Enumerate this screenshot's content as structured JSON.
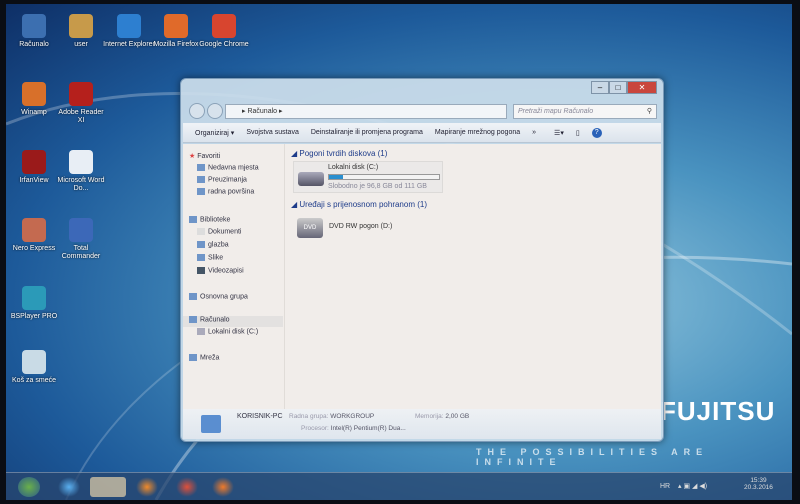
{
  "desktop": {
    "icons": [
      {
        "label": "Računalo",
        "color": "#3c6fb0"
      },
      {
        "label": "user",
        "color": "#c79a4a"
      },
      {
        "label": "Internet Explorer",
        "color": "#2d7fd0"
      },
      {
        "label": "Mozilla Firefox",
        "color": "#e06a2a"
      },
      {
        "label": "Google Chrome",
        "color": "#d8452f"
      },
      {
        "label": "Winamp",
        "color": "#d8702a"
      },
      {
        "label": "Adobe Reader XI",
        "color": "#b5201c"
      },
      {
        "label": "IrfanView",
        "color": "#9a1a1a"
      },
      {
        "label": "Microsoft Word Do...",
        "color": "#e8eef5"
      },
      {
        "label": "Nero Express",
        "color": "#c46a50"
      },
      {
        "label": "Total Commander",
        "color": "#3c68b8"
      },
      {
        "label": "BSPlayer PRO",
        "color": "#2b9ab8"
      },
      {
        "label": "Koš za smeće",
        "color": "#c9dbe6"
      }
    ],
    "brand": "FUJITSU",
    "slogan": "THE POSSIBILITIES ARE INFINITE"
  },
  "window": {
    "address": "Računalo",
    "search_placeholder": "Pretraži mapu Računalo",
    "toolbar": [
      "Organiziraj ▾",
      "Svojstva sustava",
      "Deinstaliranje ili promjena programa",
      "Mapiranje mrežnog pogona",
      "»"
    ],
    "nav": {
      "favorites": "Favoriti",
      "fav_items": [
        "Nedavna mjesta",
        "Preuzimanja",
        "radna površina"
      ],
      "libraries": "Biblioteke",
      "lib_items": [
        "Dokumenti",
        "glazba",
        "Slike",
        "Videozapisi"
      ],
      "homegroup": "Osnovna grupa",
      "computer": "Računalo",
      "computer_items": [
        "Lokalni disk (C:)"
      ],
      "network": "Mreža"
    },
    "groups": {
      "hdd": "Pogoni tvrdih diskova (1)",
      "removable": "Uređaji s prijenosnom pohranom (1)"
    },
    "drive_c": {
      "name": "Lokalni disk (C:)",
      "free": "Slobodno je 96,8 GB od 111 GB",
      "used_fraction": 0.13
    },
    "drive_d": {
      "name": "DVD RW pogon (D:)"
    },
    "details": {
      "pc": "KORISNIK-PC",
      "workgroup_label": "Radna grupa:",
      "workgroup": "WORKGROUP",
      "memory_label": "Memorija:",
      "memory": "2,00 GB",
      "cpu_label": "Procesor:",
      "cpu": "Intel(R) Pentium(R) Dua..."
    }
  },
  "taskbar": {
    "lang": "HR",
    "time": "15:39",
    "date": "20.3.2016"
  }
}
